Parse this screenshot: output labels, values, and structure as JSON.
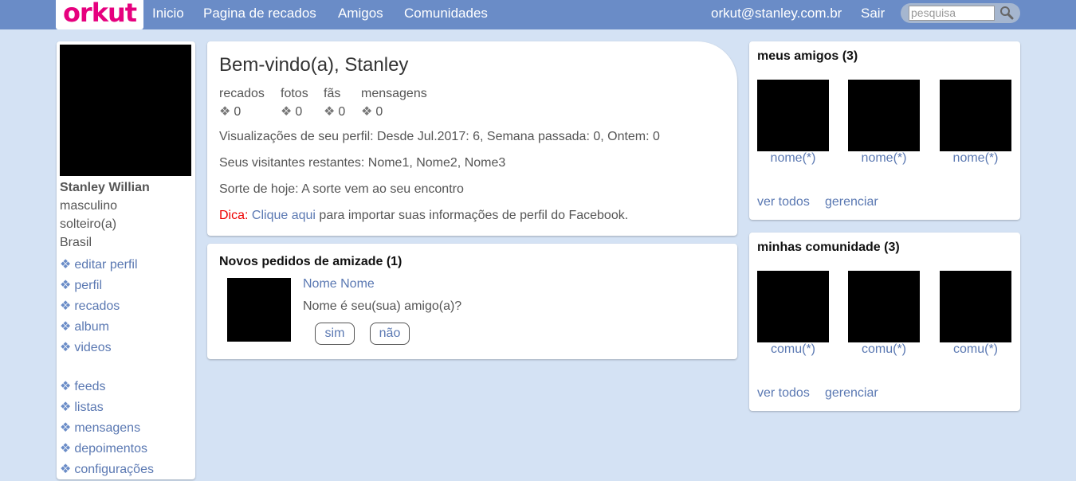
{
  "topbar": {
    "logo": "orkut",
    "nav": [
      "Inicio",
      "Pagina de recados",
      "Amigos",
      "Comunidades"
    ],
    "email": "orkut@stanley.com.br",
    "logout": "Sair",
    "search_placeholder": "pesquisa"
  },
  "colors": {
    "topbar": "#6a8cc7",
    "background": "#d4e2f4",
    "logo": "#e6007e",
    "link": "#5a78b2",
    "tip": "#e00000"
  },
  "profile": {
    "name": "Stanley Willian",
    "gender": "masculino",
    "status": "solteiro(a)",
    "country": "Brasil",
    "bullet": "❖",
    "menu1": [
      "editar perfil",
      "perfil",
      "recados",
      "album",
      "videos"
    ],
    "menu2": [
      "feeds",
      "listas",
      "mensagens",
      "depoimentos",
      "configurações"
    ]
  },
  "welcome": {
    "title": "Bem-vindo(a), Stanley",
    "stats": [
      {
        "label": "recados",
        "value": "0"
      },
      {
        "label": "fotos",
        "value": "0"
      },
      {
        "label": "fãs",
        "value": "0"
      },
      {
        "label": "mensagens",
        "value": "0"
      }
    ],
    "views": "Visualizações de seu perfil: Desde Jul.2017: 6, Semana passada: 0, Ontem: 0",
    "visitors": "Seus visitantes restantes: Nome1, Nome2, Nome3",
    "luck": "Sorte de hoje: A sorte vem ao seu encontro",
    "tip_label": "Dica:",
    "tip_link": "Clique aqui",
    "tip_text": "para importar suas informações de perfil do Facebook."
  },
  "requests": {
    "title": "Novos pedidos de amizade (1)",
    "name": "Nome Nome",
    "question": "Nome é seu(sua) amigo(a)?",
    "yes": "sim",
    "no": "não"
  },
  "friends": {
    "title": "meus amigos (3)",
    "items": [
      "nome(*)",
      "nome(*)",
      "nome(*)"
    ],
    "see_all": "ver todos",
    "manage": "gerenciar"
  },
  "communities": {
    "title": "minhas comunidade (3)",
    "items": [
      "comu(*)",
      "comu(*)",
      "comu(*)"
    ],
    "see_all": "ver todos",
    "manage": "gerenciar"
  }
}
